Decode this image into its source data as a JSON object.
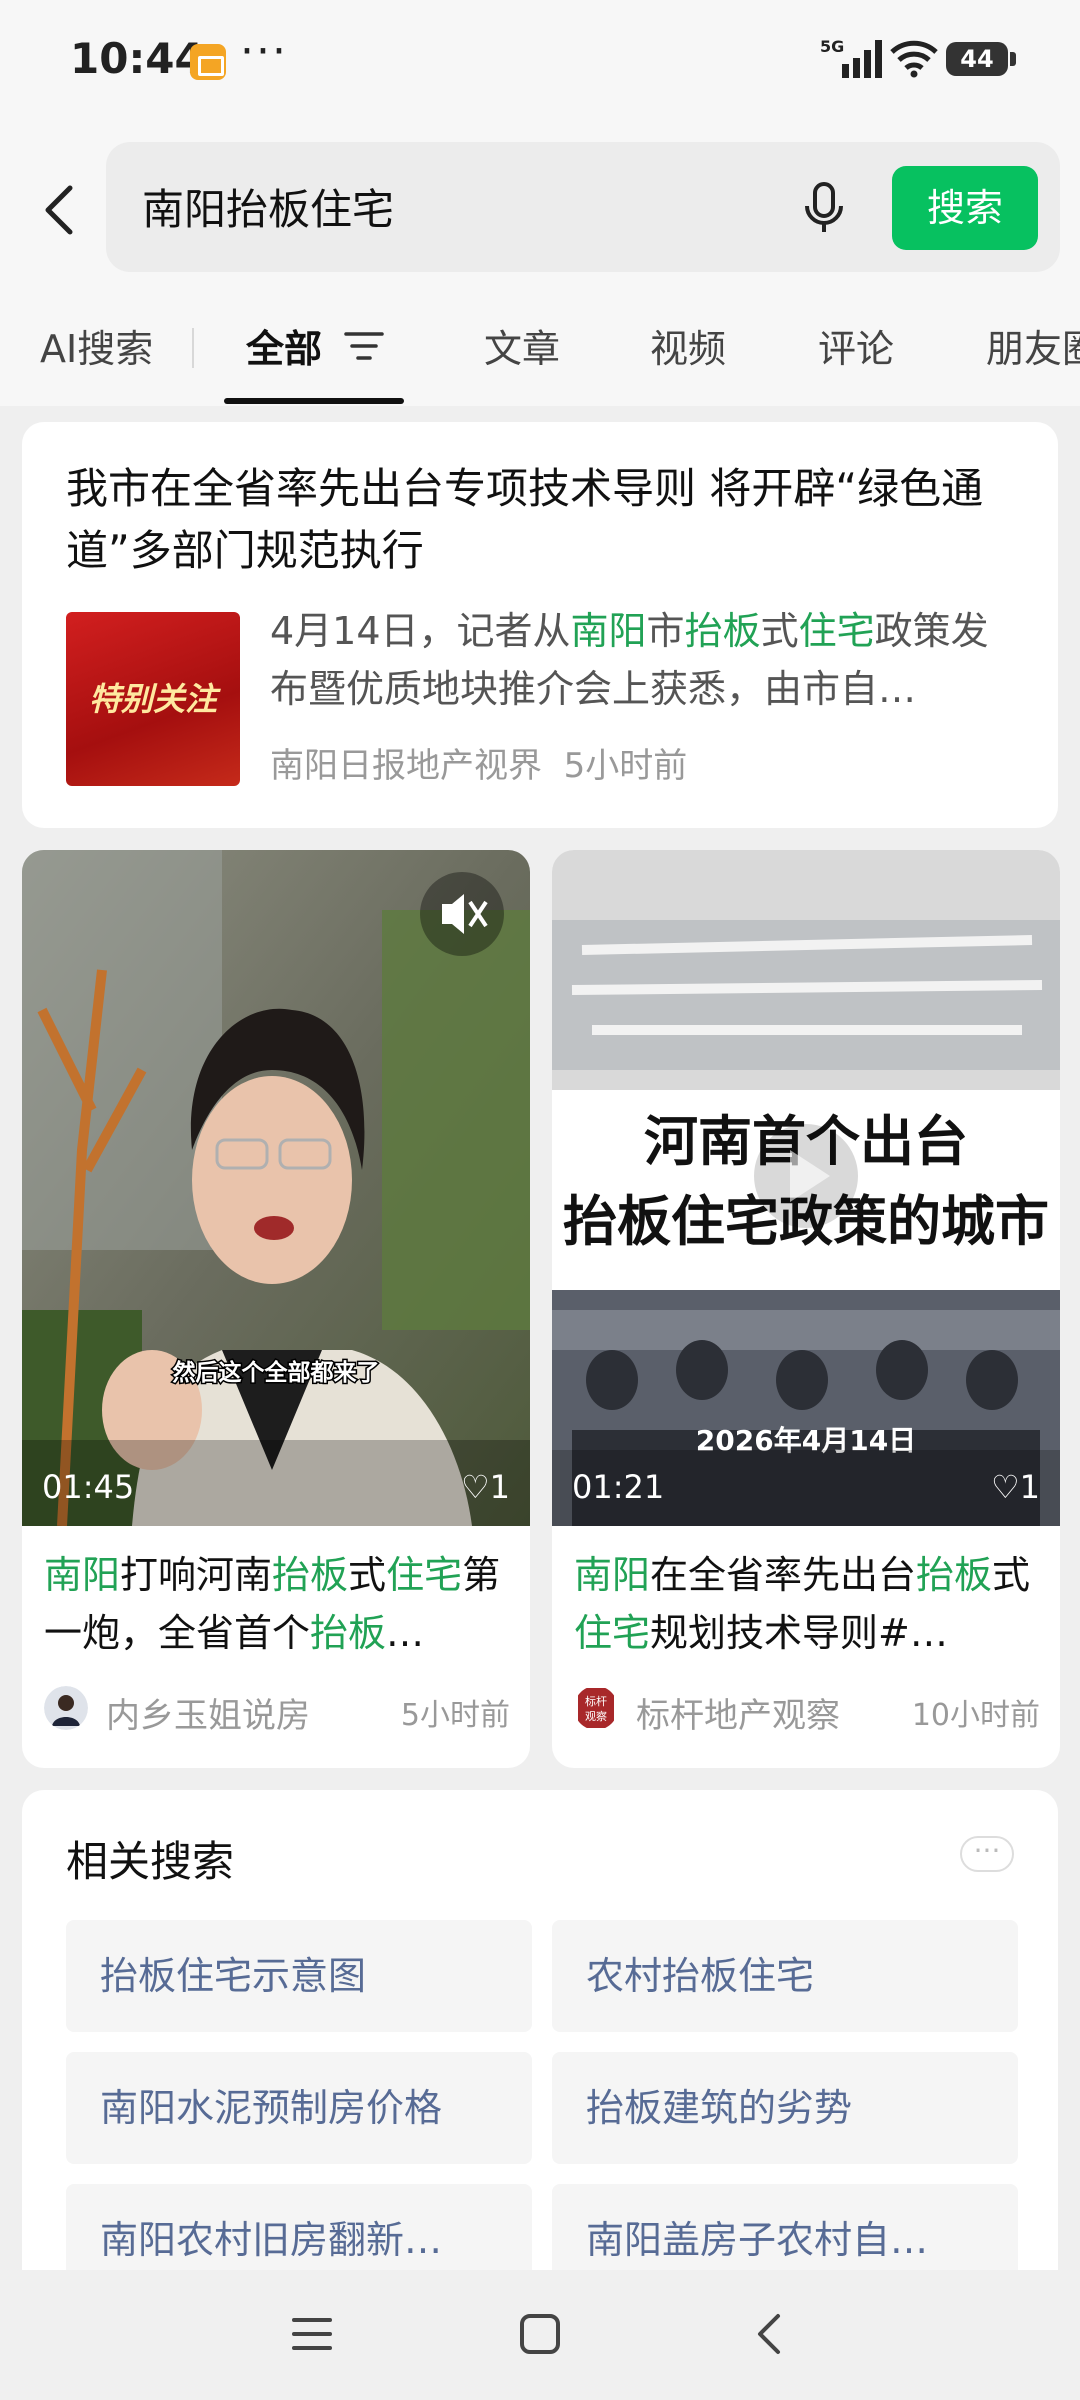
{
  "status": {
    "time": "10:44",
    "network": "5G",
    "battery": "44",
    "more_dots": "···"
  },
  "search": {
    "query": "南阳抬板住宅",
    "button_label": "搜索"
  },
  "tabs": [
    {
      "label": "AI搜索"
    },
    {
      "label": "全部"
    },
    {
      "label": "文章"
    },
    {
      "label": "视频"
    },
    {
      "label": "评论"
    },
    {
      "label": "朋友圈"
    }
  ],
  "article": {
    "title": "我市在全省率先出台专项技术导则 将开辟“绿色通道”多部门规范执行",
    "thumb_text": "特别关注",
    "summary_parts": [
      "4月14日，记者从",
      "南阳",
      "市",
      "抬板",
      "式",
      "住宅",
      "政策发布暨优质地块推介会上获悉，由市自…"
    ],
    "source": "南阳日报地产视界",
    "time": "5小时前"
  },
  "videos": [
    {
      "duration": "01:45",
      "likes": "1",
      "caption": "然后这个全部都来了",
      "title_parts": [
        "南阳",
        "打响河南",
        "抬板",
        "式",
        "住宅",
        "第一炮，全省首个",
        "抬板",
        "…"
      ],
      "author": "内乡玉姐说房",
      "time": "5小时前"
    },
    {
      "duration": "01:21",
      "likes": "1",
      "overlay_line1": "河南首个出台",
      "overlay_line2": "抬板住宅政策的城市",
      "overlay_date": "2026年4月14日",
      "avatar_text": "标杆观察",
      "title_parts": [
        "南阳",
        "在全省率先出台",
        "抬板",
        "式",
        "住宅",
        "规划技术导则#…"
      ],
      "author": "标杆地产观察",
      "time": "10小时前"
    }
  ],
  "related": {
    "title": "相关搜索",
    "more": "···",
    "items": [
      "抬板住宅示意图",
      "农村抬板住宅",
      "南阳水泥预制房价格",
      "抬板建筑的劣势",
      "南阳农村旧房翻新…",
      "南阳盖房子农村自…"
    ]
  },
  "colors": {
    "accent": "#07c160",
    "highlight": "#21a255",
    "link": "#576b95"
  }
}
